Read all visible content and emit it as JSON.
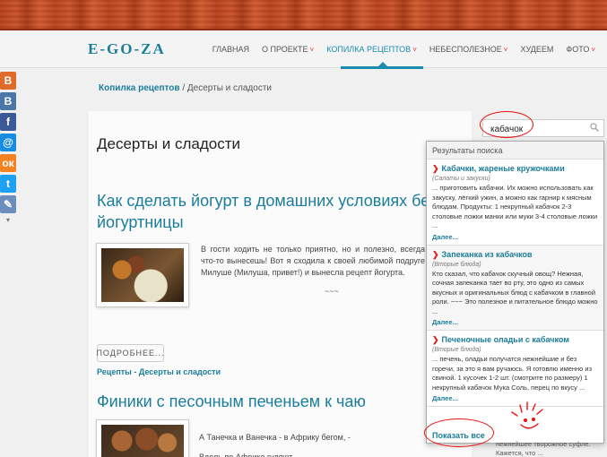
{
  "nav": {
    "logo": "E-GO-ZA",
    "items": [
      {
        "label": "ГЛАВНАЯ",
        "active": false,
        "dropdown": false
      },
      {
        "label": "О ПРОЕКТЕ",
        "active": false,
        "dropdown": true
      },
      {
        "label": "КОПИЛКА РЕЦЕПТОВ",
        "active": true,
        "dropdown": true
      },
      {
        "label": "НЕБЕСПОЛЕЗНОЕ",
        "active": false,
        "dropdown": true
      },
      {
        "label": "ХУДЕЕМ",
        "active": false,
        "dropdown": false
      },
      {
        "label": "ФОТО",
        "active": false,
        "dropdown": true
      }
    ],
    "chevron": "˅"
  },
  "social": {
    "icons": [
      {
        "name": "blogger-icon",
        "glyph": "B",
        "cls": "soc-blog"
      },
      {
        "name": "vk-icon",
        "glyph": "B",
        "cls": "soc-vk"
      },
      {
        "name": "facebook-icon",
        "glyph": "f",
        "cls": "soc-fb"
      },
      {
        "name": "mailru-icon",
        "glyph": "@",
        "cls": "soc-mail"
      },
      {
        "name": "odnoklassniki-icon",
        "glyph": "ок",
        "cls": "soc-ok"
      },
      {
        "name": "twitter-icon",
        "glyph": "t",
        "cls": "soc-tw"
      },
      {
        "name": "clip-icon",
        "glyph": "✎",
        "cls": "soc-cl"
      }
    ],
    "more": "▾"
  },
  "breadcrumb": {
    "link": "Копилка рецептов",
    "separator": "/",
    "current": "Десерты и сладости"
  },
  "page": {
    "title": "Десерты и сладости"
  },
  "articles": [
    {
      "title_lead": "Как",
      "title_rest": "сделать йогурт в домашних условиях без йогуртницы",
      "text": "В гости ходить не только приятно, но и полезно, всегда что-то вынесешь! Вот я сходила к своей любимой подруге Милуше (Милуша, привет!) и вынесла рецепт йогурта.",
      "tilde": "~~~",
      "more_label": "ПОДРОБНЕЕ...",
      "cats_prefix": "Рецепты",
      "cats_sep": " - ",
      "cats_current": "Десерты и сладости"
    },
    {
      "title": "Финики с песочным печеньем к чаю",
      "lines": [
        "А Танечка и Ванечка - в Африку бегом, -",
        "Вдоль по Африке гуляют,"
      ]
    }
  ],
  "search": {
    "query": "кабачок",
    "results_header": "Результаты поиска",
    "results": [
      {
        "title": "Кабачки, жареные кружочками",
        "category": "(Салаты и закуски)",
        "snippet": "... приготовить кабачки. Их можно использовать как закуску, лёгкий ужин, а можно как гарнир к мясным блюдам.   Продукты:  1 некрупный кабачок 2-3 столовые ложки манки или муки 3-4 столовые ложки ...",
        "more": "Далее..."
      },
      {
        "title": "Запеканка из кабачков",
        "category": "(Вторые блюда)",
        "snippet": "Кто сказал, что кабачок скучный овощ? Нежная, сочная запеканка тает во рту, это одно из самых вкусных и оригинальных блюд с кабачком в главной роли. ~~~ Это полезное и питательное блюдо можно ...",
        "more": "Далее..."
      },
      {
        "title": "Печеночные оладьи с кабачком",
        "category": "(Вторые блюда)",
        "snippet": "... печень, оладьи получатся нежнейшие и без горечи, за это я вам ручаюсь. Я готовлю именно из свиной. 1 кусочек 1-2 шт. (смотрите по размеру) 1 некрупный кабачок Мука Соль, перец по вкусу ...",
        "more": "Далее..."
      }
    ],
    "show_all": "Показать все"
  },
  "sidebar_tail": "нежнейшее творожное суфле. Кажется, что ..."
}
